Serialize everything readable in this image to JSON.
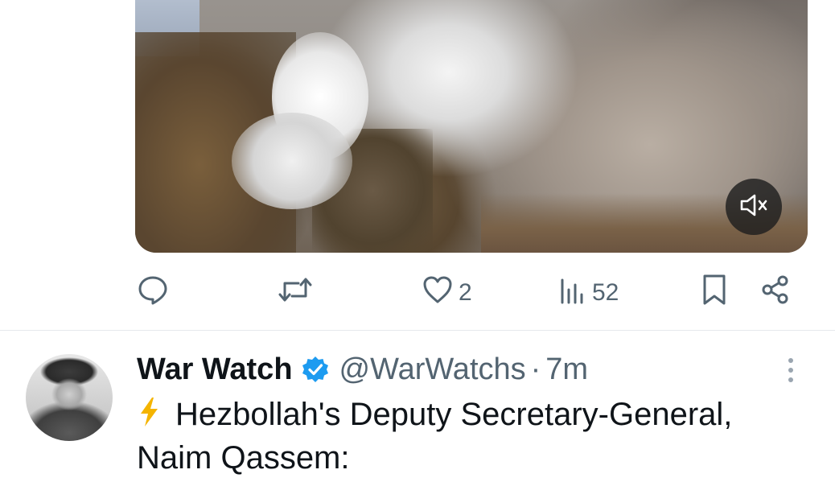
{
  "video": {
    "mute_icon": "volume-mute-icon"
  },
  "actions": {
    "reply": {
      "icon": "reply-icon",
      "count": ""
    },
    "retweet": {
      "icon": "retweet-icon",
      "count": ""
    },
    "like": {
      "icon": "heart-icon",
      "count": "2"
    },
    "views": {
      "icon": "views-chart-icon",
      "count": "52"
    },
    "bookmark": {
      "icon": "bookmark-icon"
    },
    "share": {
      "icon": "share-icon"
    }
  },
  "next_post": {
    "author_name": "War Watch",
    "verified_icon": "verified-badge-icon",
    "handle": "@WarWatchs",
    "separator": "·",
    "time": "7m",
    "more_icon": "more-options-icon",
    "emoji_icon": "lightning-icon",
    "text_line1": "Hezbollah's Deputy Secretary-General,",
    "text_line2": "Naim Qassem:"
  },
  "colors": {
    "text_primary": "#0f1419",
    "text_secondary": "#536471",
    "verified_blue": "#1d9bf0",
    "lightning": "#f4b400"
  }
}
